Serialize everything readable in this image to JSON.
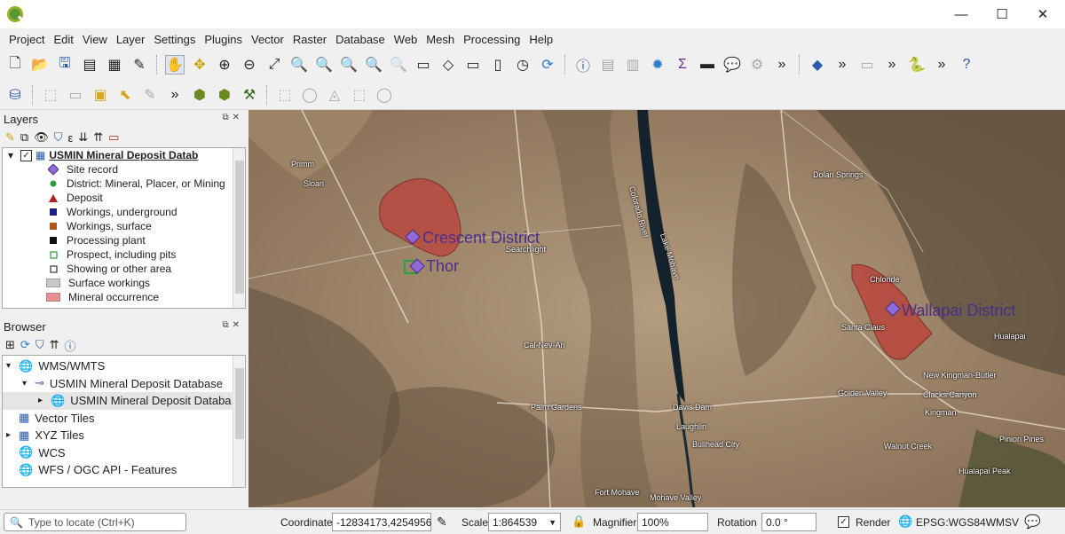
{
  "window": {
    "minimize": "—",
    "maximize": "☐",
    "close": "✕"
  },
  "menu": [
    "Project",
    "Edit",
    "View",
    "Layer",
    "Settings",
    "Plugins",
    "Vector",
    "Raster",
    "Database",
    "Web",
    "Mesh",
    "Processing",
    "Help"
  ],
  "layers_panel": {
    "title": "Layers",
    "layer_name": "USMIN Mineral Deposit Datab",
    "legend": [
      {
        "label": "Site record",
        "symbol": "diamond",
        "color": "#8e6bd6"
      },
      {
        "label": "District: Mineral, Placer, or Mining",
        "symbol": "dot",
        "color": "#2a9a3a"
      },
      {
        "label": "Deposit",
        "symbol": "triangle",
        "color": "#b02020"
      },
      {
        "label": "Workings, underground",
        "symbol": "square",
        "color": "#1f1f8c"
      },
      {
        "label": "Workings, surface",
        "symbol": "square",
        "color": "#b05a1a"
      },
      {
        "label": "Processing plant",
        "symbol": "square",
        "color": "#111111"
      },
      {
        "label": "Prospect, including pits",
        "symbol": "hollow-square",
        "color": "#2a9a3a"
      },
      {
        "label": "Showing or other area",
        "symbol": "hollow-square",
        "color": "#333333"
      },
      {
        "label": "Surface workings",
        "symbol": "rect",
        "color": "#c8c8c8"
      },
      {
        "label": "Mineral occurrence",
        "symbol": "rect",
        "color": "#e89090"
      }
    ]
  },
  "browser_panel": {
    "title": "Browser",
    "items": [
      {
        "label": "WMS/WMTS",
        "icon": "globe-icon",
        "indent": 0,
        "arrow": "▾"
      },
      {
        "label": "USMIN Mineral Deposit Database",
        "icon": "connection-icon",
        "indent": 1,
        "arrow": "▾"
      },
      {
        "label": "USMIN Mineral Deposit Databa",
        "icon": "globe-icon",
        "indent": 2,
        "arrow": "▸",
        "selected": true
      },
      {
        "label": "Vector Tiles",
        "icon": "grid-icon",
        "indent": 0,
        "arrow": ""
      },
      {
        "label": "XYZ Tiles",
        "icon": "grid-icon",
        "indent": 0,
        "arrow": "▸"
      },
      {
        "label": "WCS",
        "icon": "globe-icon",
        "indent": 0,
        "arrow": ""
      },
      {
        "label": "WFS / OGC API - Features",
        "icon": "globe-icon",
        "indent": 0,
        "arrow": ""
      }
    ]
  },
  "status": {
    "locator_placeholder": "Type to locate (Ctrl+K)",
    "coordinate_label": "Coordinate",
    "coordinate_value": "-12834173,4254956",
    "scale_label": "Scale",
    "scale_value": "1:864539",
    "magnifier_label": "Magnifier",
    "magnifier_value": "100%",
    "rotation_label": "Rotation",
    "rotation_value": "0.0 °",
    "render_label": "Render",
    "crs": "EPSG:WGS84WMSV"
  },
  "map": {
    "features": [
      {
        "label": "Crescent District"
      },
      {
        "label": "Thor"
      },
      {
        "label": "Wallapai District"
      }
    ],
    "basemap_labels": [
      "Primm",
      "Searchlight",
      "Cal-Nev-Ari",
      "Palm Gardens",
      "Davis Dam",
      "Laughlin",
      "Bullhead City",
      "Mohave Valley",
      "Golden Valley",
      "Kingman",
      "New Kingman-Butler",
      "Clacks Canyon",
      "Dolan Springs",
      "Santa Claus",
      "Chloride",
      "Hualapai",
      "Walnut Creek",
      "Pinion Pines",
      "Hualapai Peak",
      "Lake Mohave",
      "Colorado River",
      "Sloan",
      "Fort Mohave"
    ]
  }
}
